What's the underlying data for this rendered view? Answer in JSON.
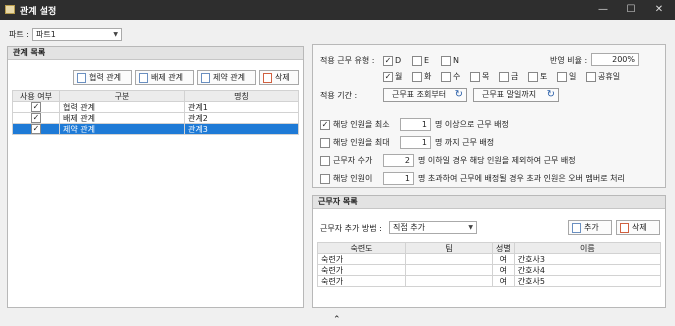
{
  "window": {
    "title": "관계 설정",
    "minimize": "—",
    "maximize": "☐",
    "close": "✕"
  },
  "part": {
    "label": "파트 :",
    "value": "파트1"
  },
  "relation_panel": {
    "title": "관계 목록",
    "buttons": [
      "협력 관계",
      "배제 관계",
      "제약 관계",
      "삭제"
    ],
    "columns": [
      "사용 여부",
      "구분",
      "명칭"
    ],
    "rows": [
      {
        "used": true,
        "type": "협력 관계",
        "name": "관계1"
      },
      {
        "used": true,
        "type": "배제 관계",
        "name": "관계2"
      },
      {
        "used": true,
        "type": "제약 관계",
        "name": "관계3"
      }
    ]
  },
  "form": {
    "duty_type_label": "적용 근무 유형 :",
    "duty_types": [
      {
        "label": "D",
        "checked": true
      },
      {
        "label": "E",
        "checked": false
      },
      {
        "label": "N",
        "checked": false
      }
    ],
    "ratio_label": "반영 비율 :",
    "ratio_value": "200%",
    "days": [
      {
        "label": "월",
        "checked": true
      },
      {
        "label": "화",
        "checked": false
      },
      {
        "label": "수",
        "checked": false
      },
      {
        "label": "목",
        "checked": false
      },
      {
        "label": "금",
        "checked": false
      },
      {
        "label": "토",
        "checked": false
      },
      {
        "label": "일",
        "checked": false
      },
      {
        "label": "공휴일",
        "checked": false
      }
    ],
    "period_label": "적용 기간 :",
    "period_from": "근무표 조회부터",
    "period_to": "근무표 말일까지",
    "rules": [
      {
        "checked": true,
        "prefix": "해당 인원을 최소",
        "value": "1",
        "suffix": "명 이상으로 근무 배정"
      },
      {
        "checked": false,
        "prefix": "해당 인원을 최대",
        "value": "1",
        "suffix": "명 까지 근무 배정"
      },
      {
        "checked": false,
        "prefix": "근무자 수가",
        "value": "2",
        "suffix": "명 이하일 경우 해당 인원을 제외하여 근무 배정"
      },
      {
        "checked": false,
        "prefix": "해당 인원이",
        "value": "1",
        "suffix": "명 초과하여 근무에 배정될 경우 초과 인원은 오버 멤버로 처리"
      }
    ]
  },
  "worker_panel": {
    "title": "근무자 목록",
    "method_label": "근무자 추가 방법 :",
    "method_value": "직접 추가",
    "add": "추가",
    "delete": "삭제",
    "columns": [
      "숙련도",
      "팀",
      "성별",
      "이름"
    ],
    "rows": [
      {
        "skill": "숙련가",
        "team": "",
        "gender": "여",
        "name": "간호사3"
      },
      {
        "skill": "숙련가",
        "team": "",
        "gender": "여",
        "name": "간호사4"
      },
      {
        "skill": "숙련가",
        "team": "",
        "gender": "여",
        "name": "간호사5"
      }
    ]
  },
  "bottom_arrow": "⌃"
}
